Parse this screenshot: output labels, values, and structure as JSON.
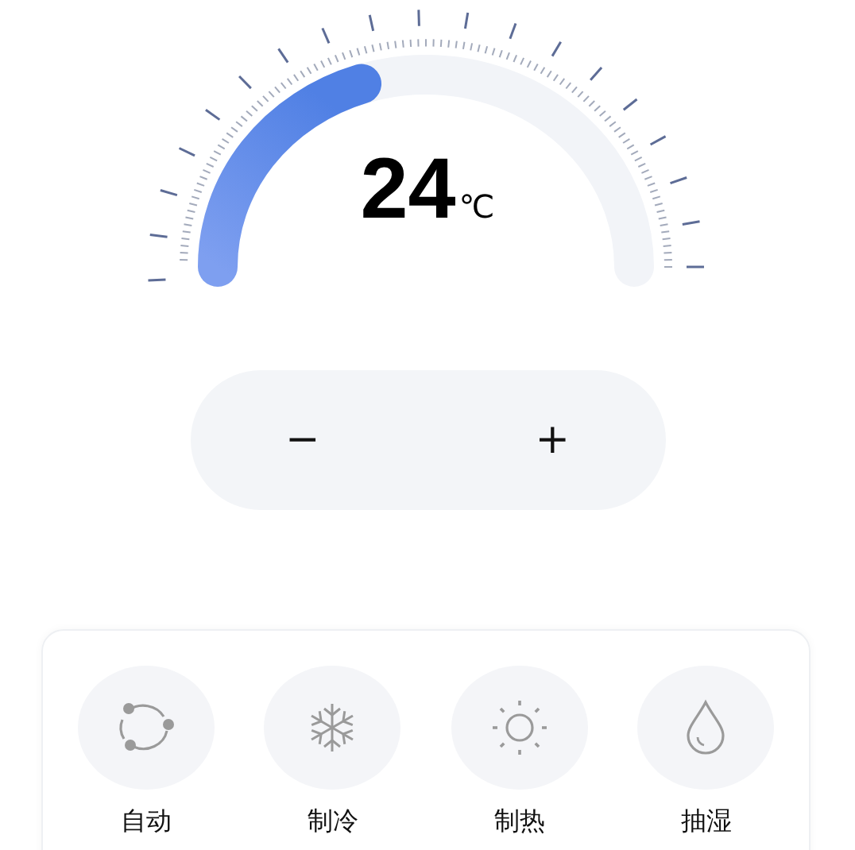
{
  "temperature": {
    "value": "24",
    "unit": "℃"
  },
  "adjust": {
    "decrease": "−",
    "increase": "+"
  },
  "modes": [
    {
      "kind": "auto",
      "label": "自动"
    },
    {
      "kind": "cool",
      "label": "制冷"
    },
    {
      "kind": "heat",
      "label": "制热"
    },
    {
      "kind": "dry",
      "label": "抽湿"
    }
  ]
}
